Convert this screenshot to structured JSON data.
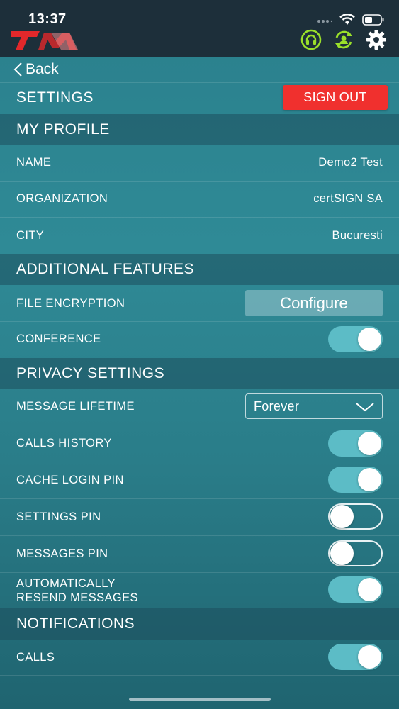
{
  "status": {
    "time": "13:37"
  },
  "nav": {
    "back_label": "Back"
  },
  "header": {
    "title": "SETTINGS",
    "sign_out_label": "SIGN OUT"
  },
  "sections": {
    "profile": "MY PROFILE",
    "additional": "ADDITIONAL FEATURES",
    "privacy": "PRIVACY SETTINGS",
    "notifications": "NOTIFICATIONS"
  },
  "profile": {
    "name_label": "NAME",
    "name_value": "Demo2 Test",
    "org_label": "ORGANIZATION",
    "org_value": "certSIGN SA",
    "city_label": "CITY",
    "city_value": "Bucuresti"
  },
  "additional": {
    "file_encryption_label": "FILE ENCRYPTION",
    "configure_label": "Configure",
    "conference_label": "CONFERENCE",
    "conference_on": true
  },
  "privacy": {
    "message_lifetime_label": "MESSAGE LIFETIME",
    "message_lifetime_value": "Forever",
    "calls_history_label": "CALLS HISTORY",
    "calls_history_on": true,
    "cache_login_pin_label": "CACHE LOGIN PIN",
    "cache_login_pin_on": true,
    "settings_pin_label": "SETTINGS PIN",
    "settings_pin_on": false,
    "messages_pin_label": "MESSAGES PIN",
    "messages_pin_on": false,
    "auto_resend_label_line1": "AUTOMATICALLY",
    "auto_resend_label_line2": "RESEND MESSAGES",
    "auto_resend_on": true
  },
  "notifications": {
    "calls_label": "CALLS",
    "calls_on": true
  },
  "colors": {
    "accent": "#5cbcc6",
    "sign_out": "#f0302e",
    "topbar": "#1d2f3a",
    "icon_green": "#9ae02a"
  },
  "icons": [
    "signal-icon",
    "wifi-icon",
    "battery-icon",
    "logo-icon",
    "headset-icon",
    "refresh-user-icon",
    "gear-icon",
    "chevron-left-icon",
    "chevron-down-icon"
  ]
}
